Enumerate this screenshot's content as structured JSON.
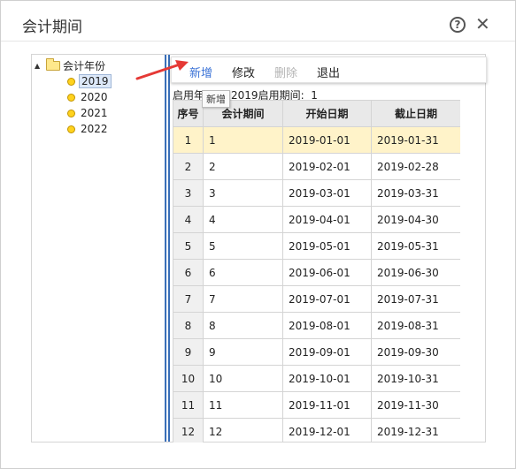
{
  "window": {
    "title": "会计期间",
    "help_icon_glyph": "?",
    "close_icon_glyph": "✕"
  },
  "tree": {
    "root_label": "会计年份",
    "root_toggle": "▲",
    "items": [
      {
        "label": "2019",
        "selected": true
      },
      {
        "label": "2020",
        "selected": false
      },
      {
        "label": "2021",
        "selected": false
      },
      {
        "label": "2022",
        "selected": false
      }
    ]
  },
  "toolbar": {
    "new_label": "新增",
    "edit_label": "修改",
    "delete_label": "删除",
    "exit_label": "退出"
  },
  "tooltip": "新增",
  "info": {
    "start_year_label": "启用年",
    "start_year_value": "2019",
    "start_period_label": "启用期间:",
    "start_period_value": "1"
  },
  "table": {
    "columns": [
      "序号",
      "会计期间",
      "开始日期",
      "截止日期"
    ],
    "rows": [
      {
        "index": "1",
        "period": "1",
        "start": "2019-01-01",
        "end": "2019-01-31"
      },
      {
        "index": "2",
        "period": "2",
        "start": "2019-02-01",
        "end": "2019-02-28"
      },
      {
        "index": "3",
        "period": "3",
        "start": "2019-03-01",
        "end": "2019-03-31"
      },
      {
        "index": "4",
        "period": "4",
        "start": "2019-04-01",
        "end": "2019-04-30"
      },
      {
        "index": "5",
        "period": "5",
        "start": "2019-05-01",
        "end": "2019-05-31"
      },
      {
        "index": "6",
        "period": "6",
        "start": "2019-06-01",
        "end": "2019-06-30"
      },
      {
        "index": "7",
        "period": "7",
        "start": "2019-07-01",
        "end": "2019-07-31"
      },
      {
        "index": "8",
        "period": "8",
        "start": "2019-08-01",
        "end": "2019-08-31"
      },
      {
        "index": "9",
        "period": "9",
        "start": "2019-09-01",
        "end": "2019-09-30"
      },
      {
        "index": "10",
        "period": "10",
        "start": "2019-10-01",
        "end": "2019-10-31"
      },
      {
        "index": "11",
        "period": "11",
        "start": "2019-11-01",
        "end": "2019-11-30"
      },
      {
        "index": "12",
        "period": "12",
        "start": "2019-12-01",
        "end": "2019-12-31"
      }
    ],
    "selected_row": 0
  },
  "colors": {
    "accent": "#3a72d6",
    "arrow": "#e53935",
    "selected_row": "#fff3c9",
    "splitter": "#3a6fb8"
  }
}
